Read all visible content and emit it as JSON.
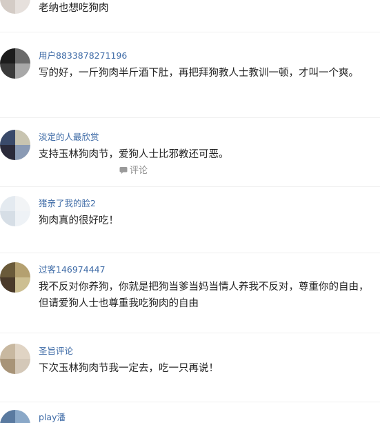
{
  "comments": [
    {
      "username": "",
      "text": "老纳也想吃狗肉",
      "avatar_colors": [
        "#9c938c",
        "#b8b0a8",
        "#d4ccc6",
        "#e6e0dc"
      ]
    },
    {
      "username": "用户8833878271196",
      "text": "写的好，一斤狗肉半斤酒下肚，再把拜狗教人士教训一顿，才叫一个爽。",
      "avatar_colors": [
        "#1c1c1c",
        "#6a6a6a",
        "#3a3a3a",
        "#a8a8a8"
      ]
    },
    {
      "username": "淡定的人最欣赏",
      "text": "支持玉林狗肉节，爱狗人士比邪教还可恶。",
      "reply_label": "评论",
      "avatar_colors": [
        "#3a4a6a",
        "#c8c4b0",
        "#2a2a3a",
        "#8a9ab4"
      ]
    },
    {
      "username": "猪亲了我的脸2",
      "text": "狗肉真的很好吃！",
      "avatar_colors": [
        "#e4eaf0",
        "#f2f4f6",
        "#d6dee6",
        "#eef2f6"
      ]
    },
    {
      "username": "过客146974447",
      "text": "我不反对你养狗，你就是把狗当爹当妈当情人养我不反对，尊重你的自由，但请爱狗人士也尊重我吃狗肉的自由",
      "avatar_colors": [
        "#6a5a3a",
        "#b4a070",
        "#4a3a2a",
        "#cdbf92"
      ]
    },
    {
      "username": "圣旨评论",
      "text": "下次玉林狗肉节我一定去，吃一只再说！",
      "avatar_colors": [
        "#c8b8a0",
        "#e0d4c4",
        "#a89478",
        "#d4c8b8"
      ]
    },
    {
      "username": "play潘",
      "text": "",
      "avatar_colors": [
        "#5a7aa0",
        "#8aa8c8",
        "#3a5a80",
        "#b4c8dc"
      ]
    }
  ]
}
